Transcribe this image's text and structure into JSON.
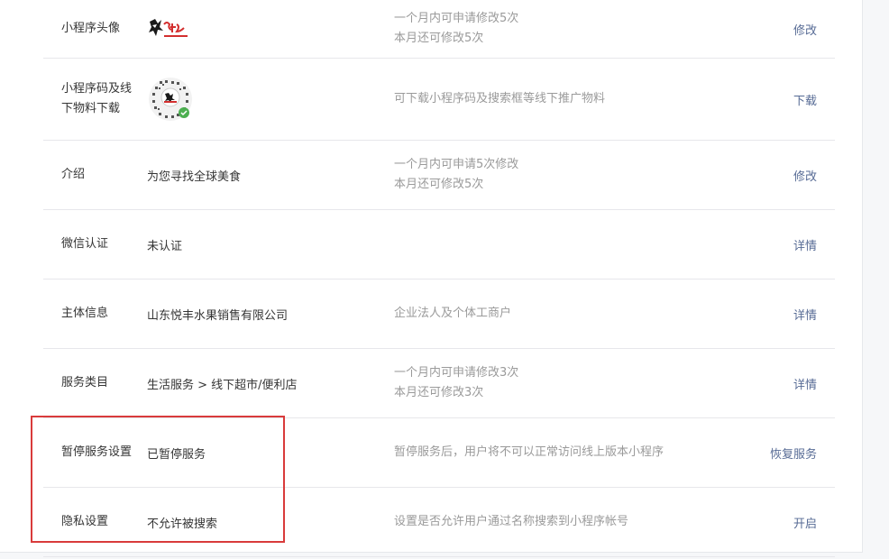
{
  "rows": [
    {
      "label": "小程序头像",
      "value_icon": "avatar-logo-icon",
      "desc": [
        "一个月内可申请修改5次",
        "本月还可修改5次"
      ],
      "action": "修改"
    },
    {
      "label": "小程序码及线下物料下载",
      "value_icon": "qrcode-icon",
      "desc": [
        "可下载小程序码及搜索框等线下推广物料"
      ],
      "action": "下载"
    },
    {
      "label": "介绍",
      "value": "为您寻找全球美食",
      "desc": [
        "一个月内可申请5次修改",
        "本月还可修改5次"
      ],
      "action": "修改"
    },
    {
      "label": "微信认证",
      "value": "未认证",
      "desc": [],
      "action": "详情"
    },
    {
      "label": "主体信息",
      "value": "山东悦丰水果销售有限公司",
      "desc": [
        "企业法人及个体工商户"
      ],
      "action": "详情"
    },
    {
      "label": "服务类目",
      "value": "生活服务 > 线下超市/便利店",
      "desc": [
        "一个月内可申请修改3次",
        "本月还可修改3次"
      ],
      "action": "详情"
    },
    {
      "label": "暂停服务设置",
      "value": "已暂停服务",
      "desc": [
        "暂停服务后，用户将不可以正常访问线上版本小程序"
      ],
      "action": "恢复服务"
    },
    {
      "label": "隐私设置",
      "value": "不允许被搜索",
      "desc": [
        "设置是否允许用户通过名称搜索到小程序帐号"
      ],
      "action": "开启"
    }
  ],
  "colors": {
    "link": "#576b95",
    "label": "#353535",
    "desc": "#9a9a9a",
    "highlight": "#d93b3b",
    "divider": "#e7e7eb"
  }
}
